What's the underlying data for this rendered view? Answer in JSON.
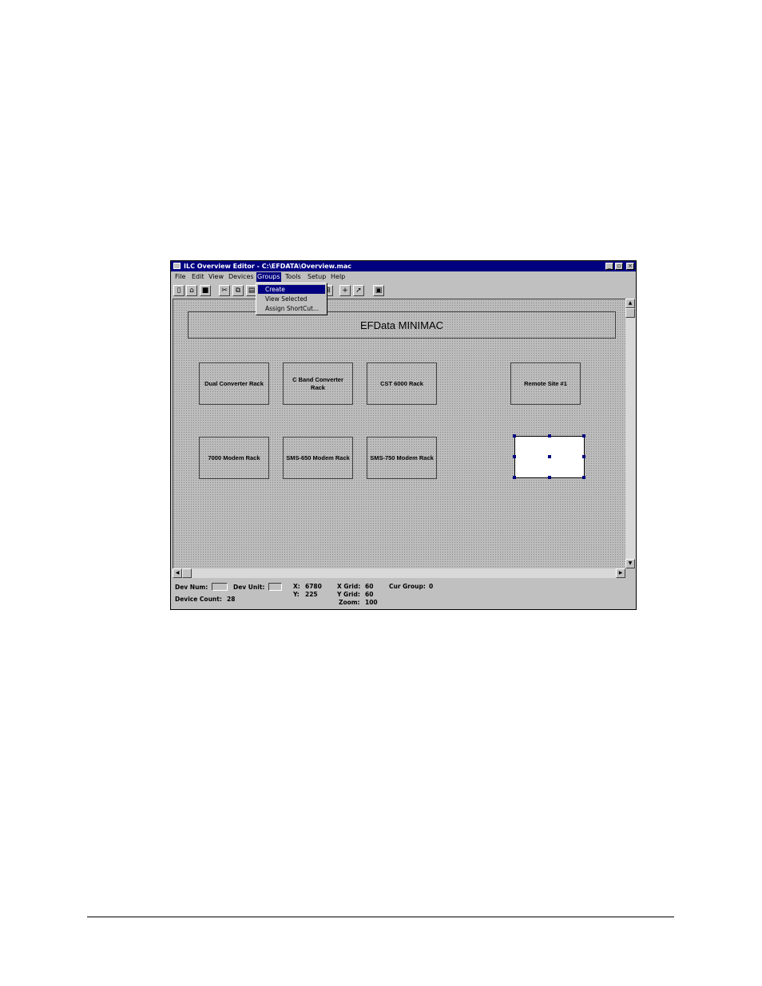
{
  "window": {
    "title": "ILC Overview Editor - C:\\EFDATA\\Overview.mac",
    "buttons": {
      "minimize": "_",
      "maximize": "▫",
      "close": "×"
    }
  },
  "menu": {
    "items": [
      "File",
      "Edit",
      "View",
      "Devices",
      "Groups",
      "Tools",
      "Setup",
      "Help"
    ],
    "active": "Groups"
  },
  "groups_menu": {
    "items": [
      "Create",
      "View Selected",
      "Assign ShortCut..."
    ],
    "highlighted": "Create"
  },
  "toolbar": {
    "icons": [
      "new-file-icon",
      "open-folder-icon",
      "save-icon",
      "cut-icon",
      "copy-icon",
      "paste-icon",
      "align-icon",
      "crosshair-icon",
      "pointer-icon",
      "properties-icon"
    ]
  },
  "canvas": {
    "title_box": "EFData MINIMAC",
    "devices": [
      "Dual Converter Rack",
      "C Band Converter Rack",
      "CST 6000 Rack",
      "Remote Site #1",
      "7000 Modem Rack",
      "SMS-650 Modem Rack",
      "SMS-750 Modem Rack"
    ]
  },
  "status": {
    "dev_num_label": "Dev Num:",
    "dev_unit_label": "Dev Unit:",
    "device_count_label": "Device Count:",
    "device_count": "28",
    "x_label": "X:",
    "x": "6780",
    "y_label": "Y:",
    "y": "225",
    "x_grid_label": "X Grid:",
    "x_grid": "60",
    "y_grid_label": "Y Grid:",
    "y_grid": "60",
    "zoom_label": "Zoom:",
    "zoom": "100",
    "cur_group_label": "Cur Group:",
    "cur_group": "0"
  },
  "colors": {
    "titlebar": "#000080",
    "face": "#c0c0c0",
    "selection_handle": "#000080"
  }
}
